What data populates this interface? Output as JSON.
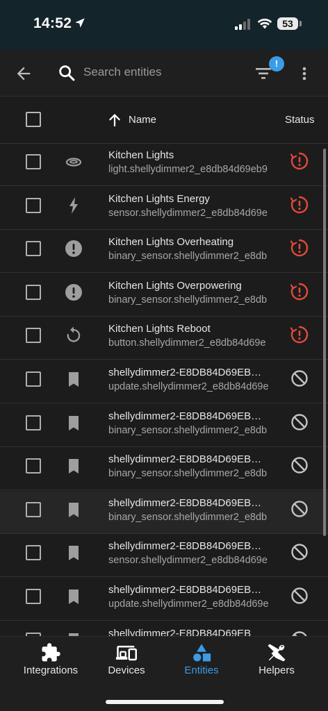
{
  "status_bar": {
    "time": "14:52",
    "battery": "53"
  },
  "toolbar": {
    "search_placeholder": "Search entities",
    "filter_badge": "!"
  },
  "table_header": {
    "name": "Name",
    "status": "Status"
  },
  "rows": [
    {
      "title": "Kitchen Lights",
      "entity_id": "light.shellydimmer2_e8db84d69eb9",
      "icon": "ceiling-light-icon",
      "status": "unavailable"
    },
    {
      "title": "Kitchen Lights Energy",
      "entity_id": "sensor.shellydimmer2_e8db84d69e",
      "icon": "lightning-bolt-icon",
      "status": "unavailable"
    },
    {
      "title": "Kitchen Lights Overheating",
      "entity_id": "binary_sensor.shellydimmer2_e8db",
      "icon": "alert-circle-icon",
      "status": "unavailable"
    },
    {
      "title": "Kitchen Lights Overpowering",
      "entity_id": "binary_sensor.shellydimmer2_e8db",
      "icon": "alert-circle-icon",
      "status": "unavailable"
    },
    {
      "title": "Kitchen Lights Reboot",
      "entity_id": "button.shellydimmer2_e8db84d69e",
      "icon": "restart-icon",
      "status": "unavailable"
    },
    {
      "title": "shellydimmer2-E8DB84D69EB…",
      "entity_id": "update.shellydimmer2_e8db84d69e",
      "icon": "bookmark-icon",
      "status": "disabled"
    },
    {
      "title": "shellydimmer2-E8DB84D69EB…",
      "entity_id": "binary_sensor.shellydimmer2_e8db",
      "icon": "bookmark-icon",
      "status": "disabled"
    },
    {
      "title": "shellydimmer2-E8DB84D69EB…",
      "entity_id": "binary_sensor.shellydimmer2_e8db",
      "icon": "bookmark-icon",
      "status": "disabled"
    },
    {
      "title": "shellydimmer2-E8DB84D69EB…",
      "entity_id": "binary_sensor.shellydimmer2_e8db",
      "icon": "bookmark-icon",
      "status": "disabled"
    },
    {
      "title": "shellydimmer2-E8DB84D69EB…",
      "entity_id": "sensor.shellydimmer2_e8db84d69e",
      "icon": "bookmark-icon",
      "status": "disabled"
    },
    {
      "title": "shellydimmer2-E8DB84D69EB…",
      "entity_id": "update.shellydimmer2_e8db84d69e",
      "icon": "bookmark-icon",
      "status": "disabled"
    },
    {
      "title": "shellydimmer2-E8DB84D69EB",
      "entity_id": "",
      "icon": "bookmark-icon",
      "status": "disabled"
    }
  ],
  "bottom_nav": [
    {
      "label": "Integrations",
      "icon": "puzzle-icon",
      "active": false
    },
    {
      "label": "Devices",
      "icon": "devices-icon",
      "active": false
    },
    {
      "label": "Entities",
      "icon": "shapes-icon",
      "active": true
    },
    {
      "label": "Helpers",
      "icon": "tools-icon",
      "active": false
    }
  ],
  "colors": {
    "accent": "#3d9be5",
    "error": "#e4493a",
    "icon": "#9e9e9e"
  }
}
